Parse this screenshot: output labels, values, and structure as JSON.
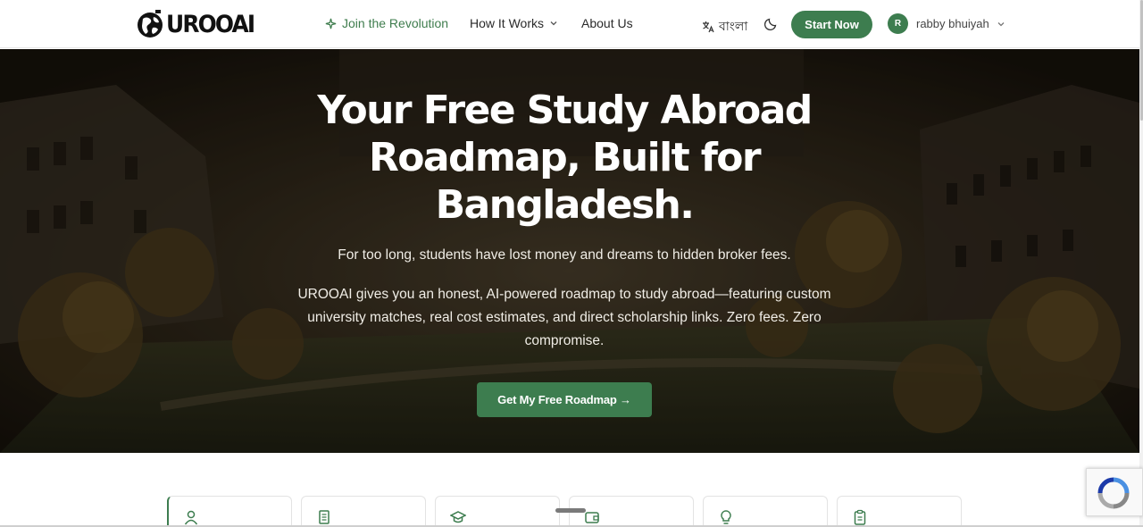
{
  "header": {
    "logo_text": "UROOAI",
    "nav": {
      "join": "Join the Revolution",
      "how": "How It Works",
      "about": "About Us"
    },
    "language": "বাংলা",
    "start_button": "Start Now",
    "user": {
      "initial": "R",
      "name": "rabby bhuiyah"
    }
  },
  "hero": {
    "title": "Your Free Study Abroad Roadmap, Built for Bangladesh.",
    "subtitle": "For too long, students have lost money and dreams to hidden broker fees.",
    "description": "UROOAI gives you an honest, AI-powered roadmap to study abroad—featuring custom university matches, real cost estimates, and direct scholarship links. Zero fees. Zero compromise.",
    "cta": "Get My Free Roadmap →"
  },
  "feature_cards": [
    {
      "icon": "user-icon"
    },
    {
      "icon": "document-icon"
    },
    {
      "icon": "graduation-cap-icon"
    },
    {
      "icon": "wallet-icon"
    },
    {
      "icon": "lightbulb-icon"
    },
    {
      "icon": "clipboard-icon"
    }
  ],
  "colors": {
    "brand_green": "#3d7d4f",
    "nav_highlight": "#3f7d4e",
    "hero_overlay": "#231c12"
  }
}
